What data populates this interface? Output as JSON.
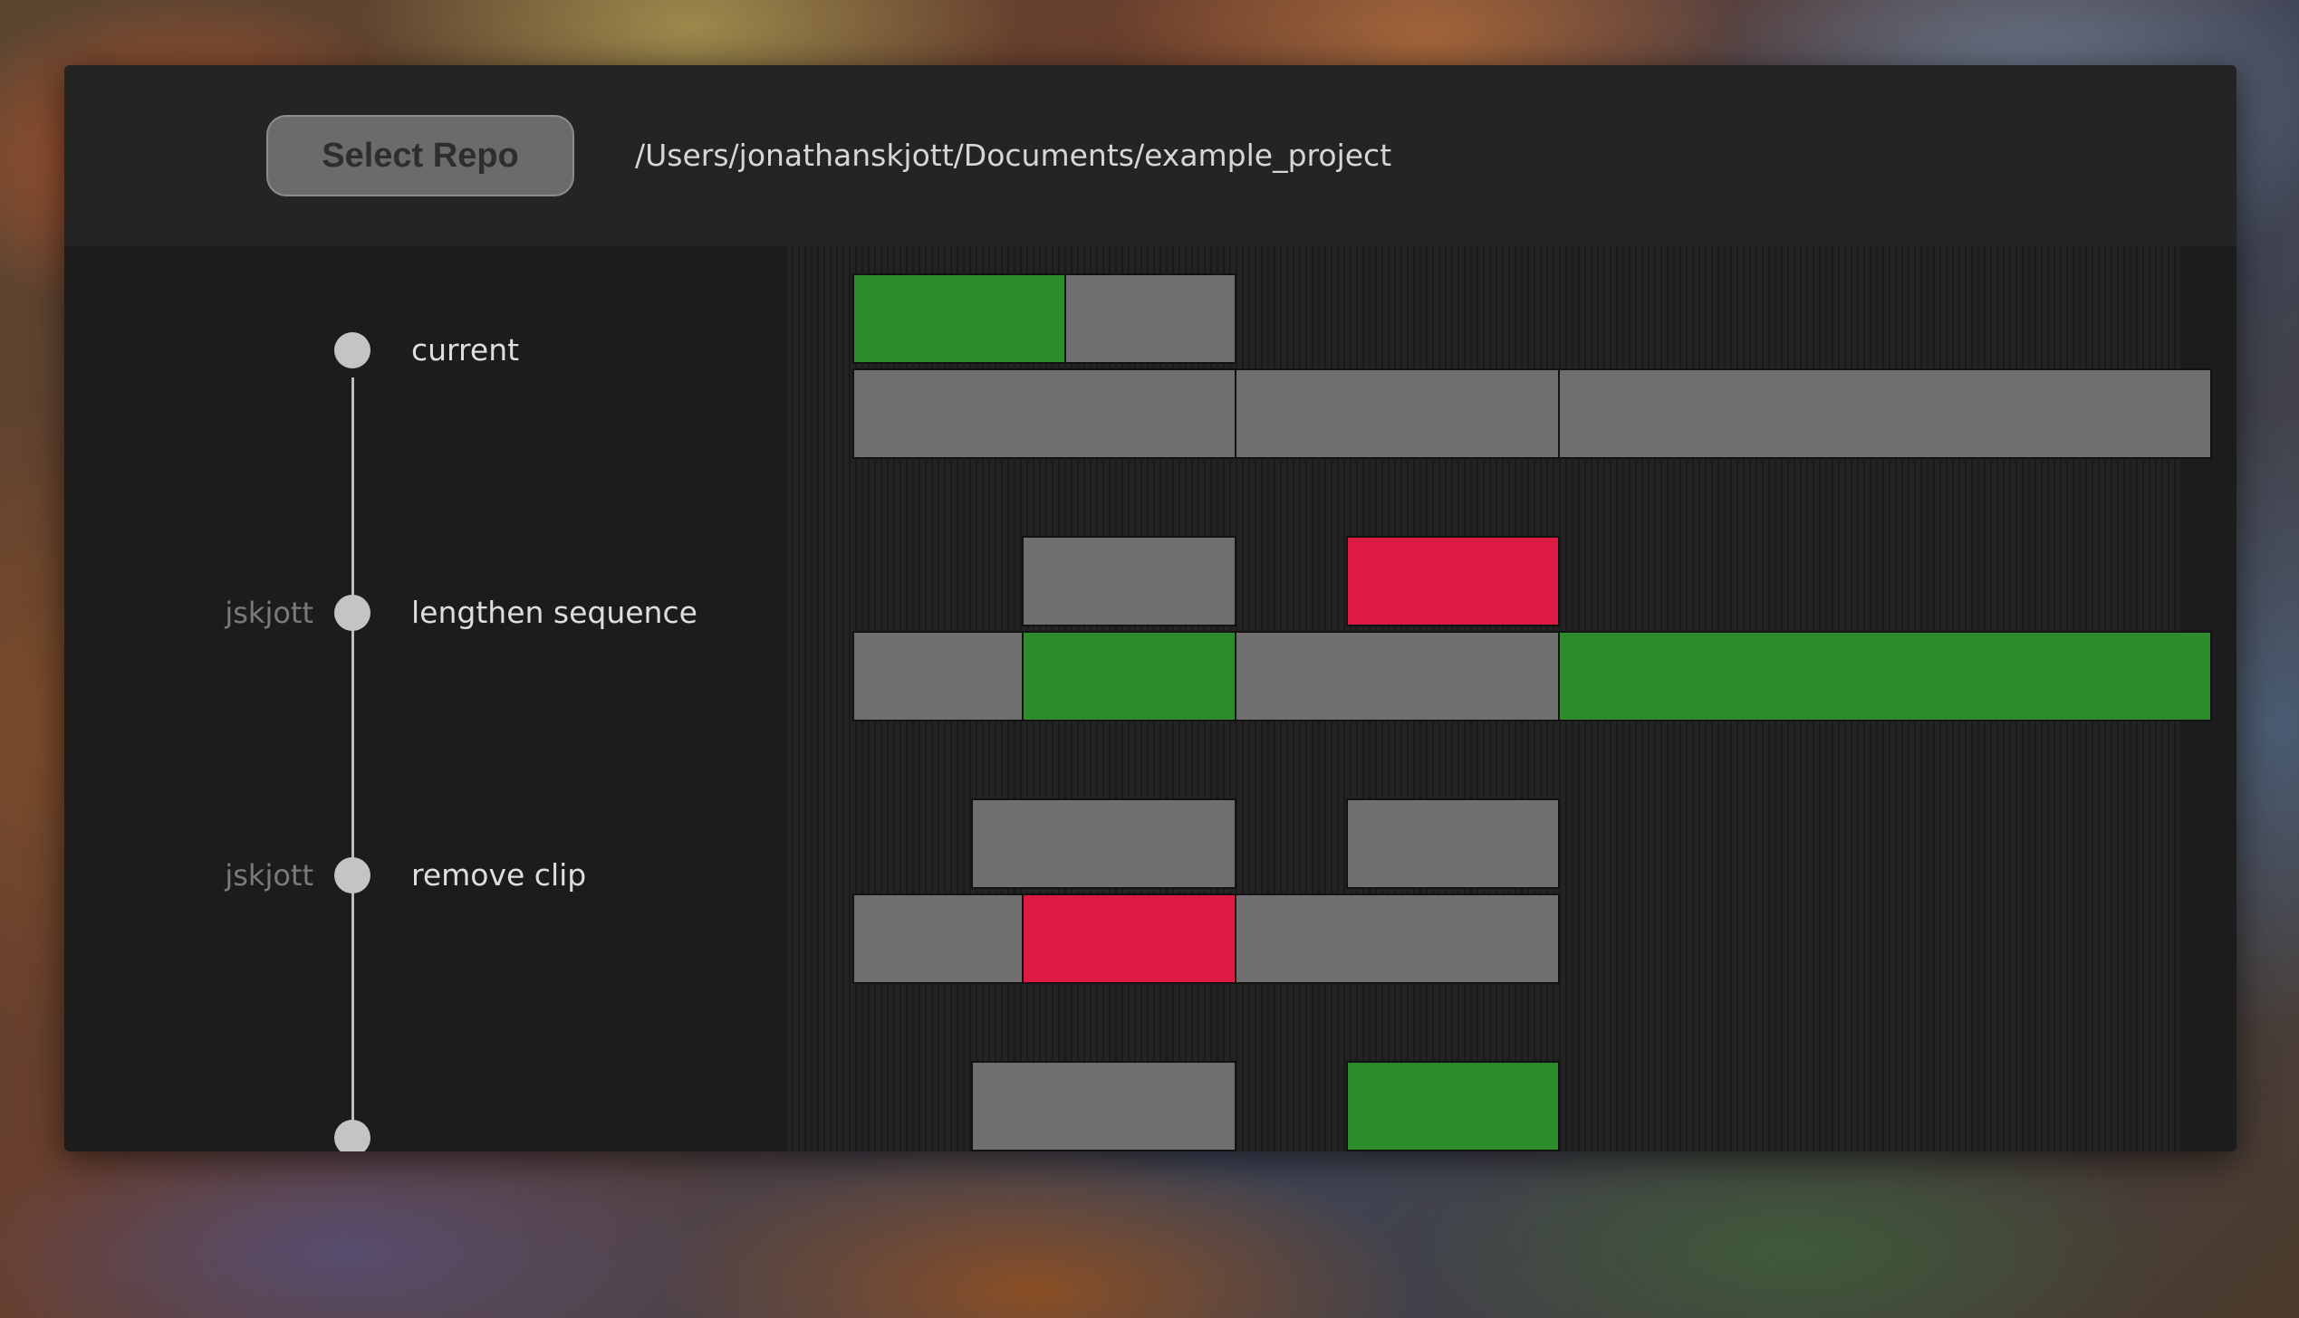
{
  "header": {
    "select_repo_label": "Select Repo",
    "repo_path": "/Users/jonathanskjott/Documents/example_project"
  },
  "colors": {
    "unchanged_clip": "#6f6f6f",
    "added_clip": "#2e8b2b",
    "removed_clip": "#dc1a43",
    "window_background": "#1c1c1c",
    "header_background": "#242424"
  },
  "commits": [
    {
      "author": "",
      "message": "current"
    },
    {
      "author": "jskjott",
      "message": "lengthen sequence"
    },
    {
      "author": "jskjott",
      "message": "remove clip"
    },
    {
      "author": "",
      "message": ""
    }
  ]
}
